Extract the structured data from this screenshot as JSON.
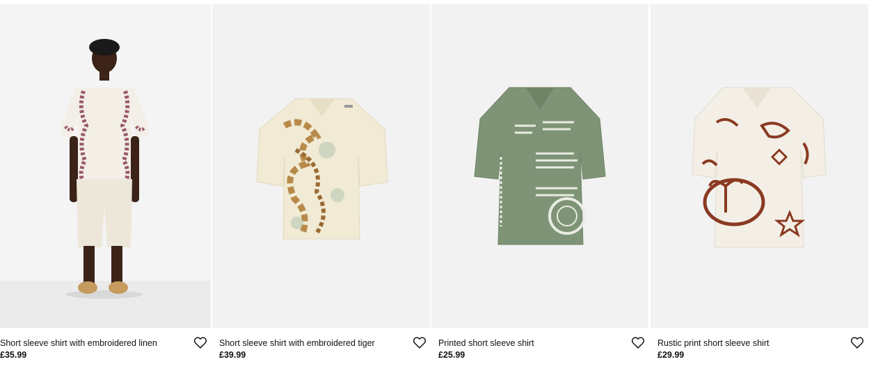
{
  "products": [
    {
      "name": "Short sleeve shirt with embroidered linen",
      "price": "£35.99",
      "wishlist_icon": "heart-outline-icon",
      "image_kind": "model-wearing-shirt"
    },
    {
      "name": "Short sleeve shirt with embroidered tiger",
      "price": "£39.99",
      "wishlist_icon": "heart-outline-icon",
      "image_kind": "shirt-cutout"
    },
    {
      "name": "Printed short sleeve shirt",
      "price": "£25.99",
      "wishlist_icon": "heart-outline-icon",
      "image_kind": "shirt-cutout"
    },
    {
      "name": "Rustic print short sleeve shirt",
      "price": "£29.99",
      "wishlist_icon": "heart-outline-icon",
      "image_kind": "shirt-cutout"
    }
  ],
  "colors": {
    "image_bg": "#f2f2f2",
    "text": "#111111",
    "linen_shirt": "#f3efe6",
    "linen_embroidery": "#9a5a6a",
    "tiger_shirt": "#f1ead4",
    "tiger_print": "#b88a4a",
    "printed_shirt": "#7f9477",
    "printed_text": "#e8ece2",
    "rustic_shirt": "#f4efe6",
    "rustic_print": "#8a3a22"
  }
}
